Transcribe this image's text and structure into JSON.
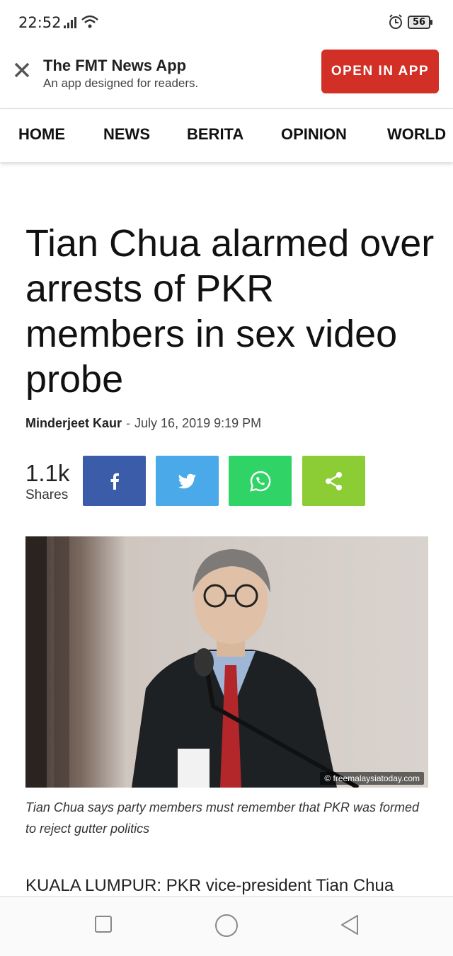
{
  "status_bar": {
    "time": "22:52",
    "battery": "56"
  },
  "banner": {
    "title": "The FMT News App",
    "subtitle": "An app designed for readers.",
    "open_label": "OPEN IN APP",
    "accent": "#d22f26"
  },
  "nav": {
    "items": [
      "HOME",
      "NEWS",
      "BERITA",
      "OPINION",
      "WORLD"
    ]
  },
  "article": {
    "headline": "Tian Chua alarmed over arrests of PKR members in sex video probe",
    "author": "Minderjeet Kaur",
    "separator": "-",
    "date": "July 16, 2019 9:19 PM",
    "shares_count": "1.1k",
    "shares_label": "Shares",
    "share_buttons": [
      {
        "icon": "facebook-icon",
        "color": "#3b5ca8"
      },
      {
        "icon": "twitter-icon",
        "color": "#4aa9e8"
      },
      {
        "icon": "whatsapp-icon",
        "color": "#2fd366"
      },
      {
        "icon": "share-icon",
        "color": "#8ccd35"
      }
    ],
    "photo_watermark": "© freemalaysiatoday.com",
    "caption": "Tian Chua says party members must remember that PKR was formed to reject gutter politics",
    "lede": "KUALA LUMPUR: PKR vice-president Tian Chua"
  },
  "system_nav": {
    "icons": [
      "recents-icon",
      "home-icon",
      "back-icon"
    ]
  }
}
